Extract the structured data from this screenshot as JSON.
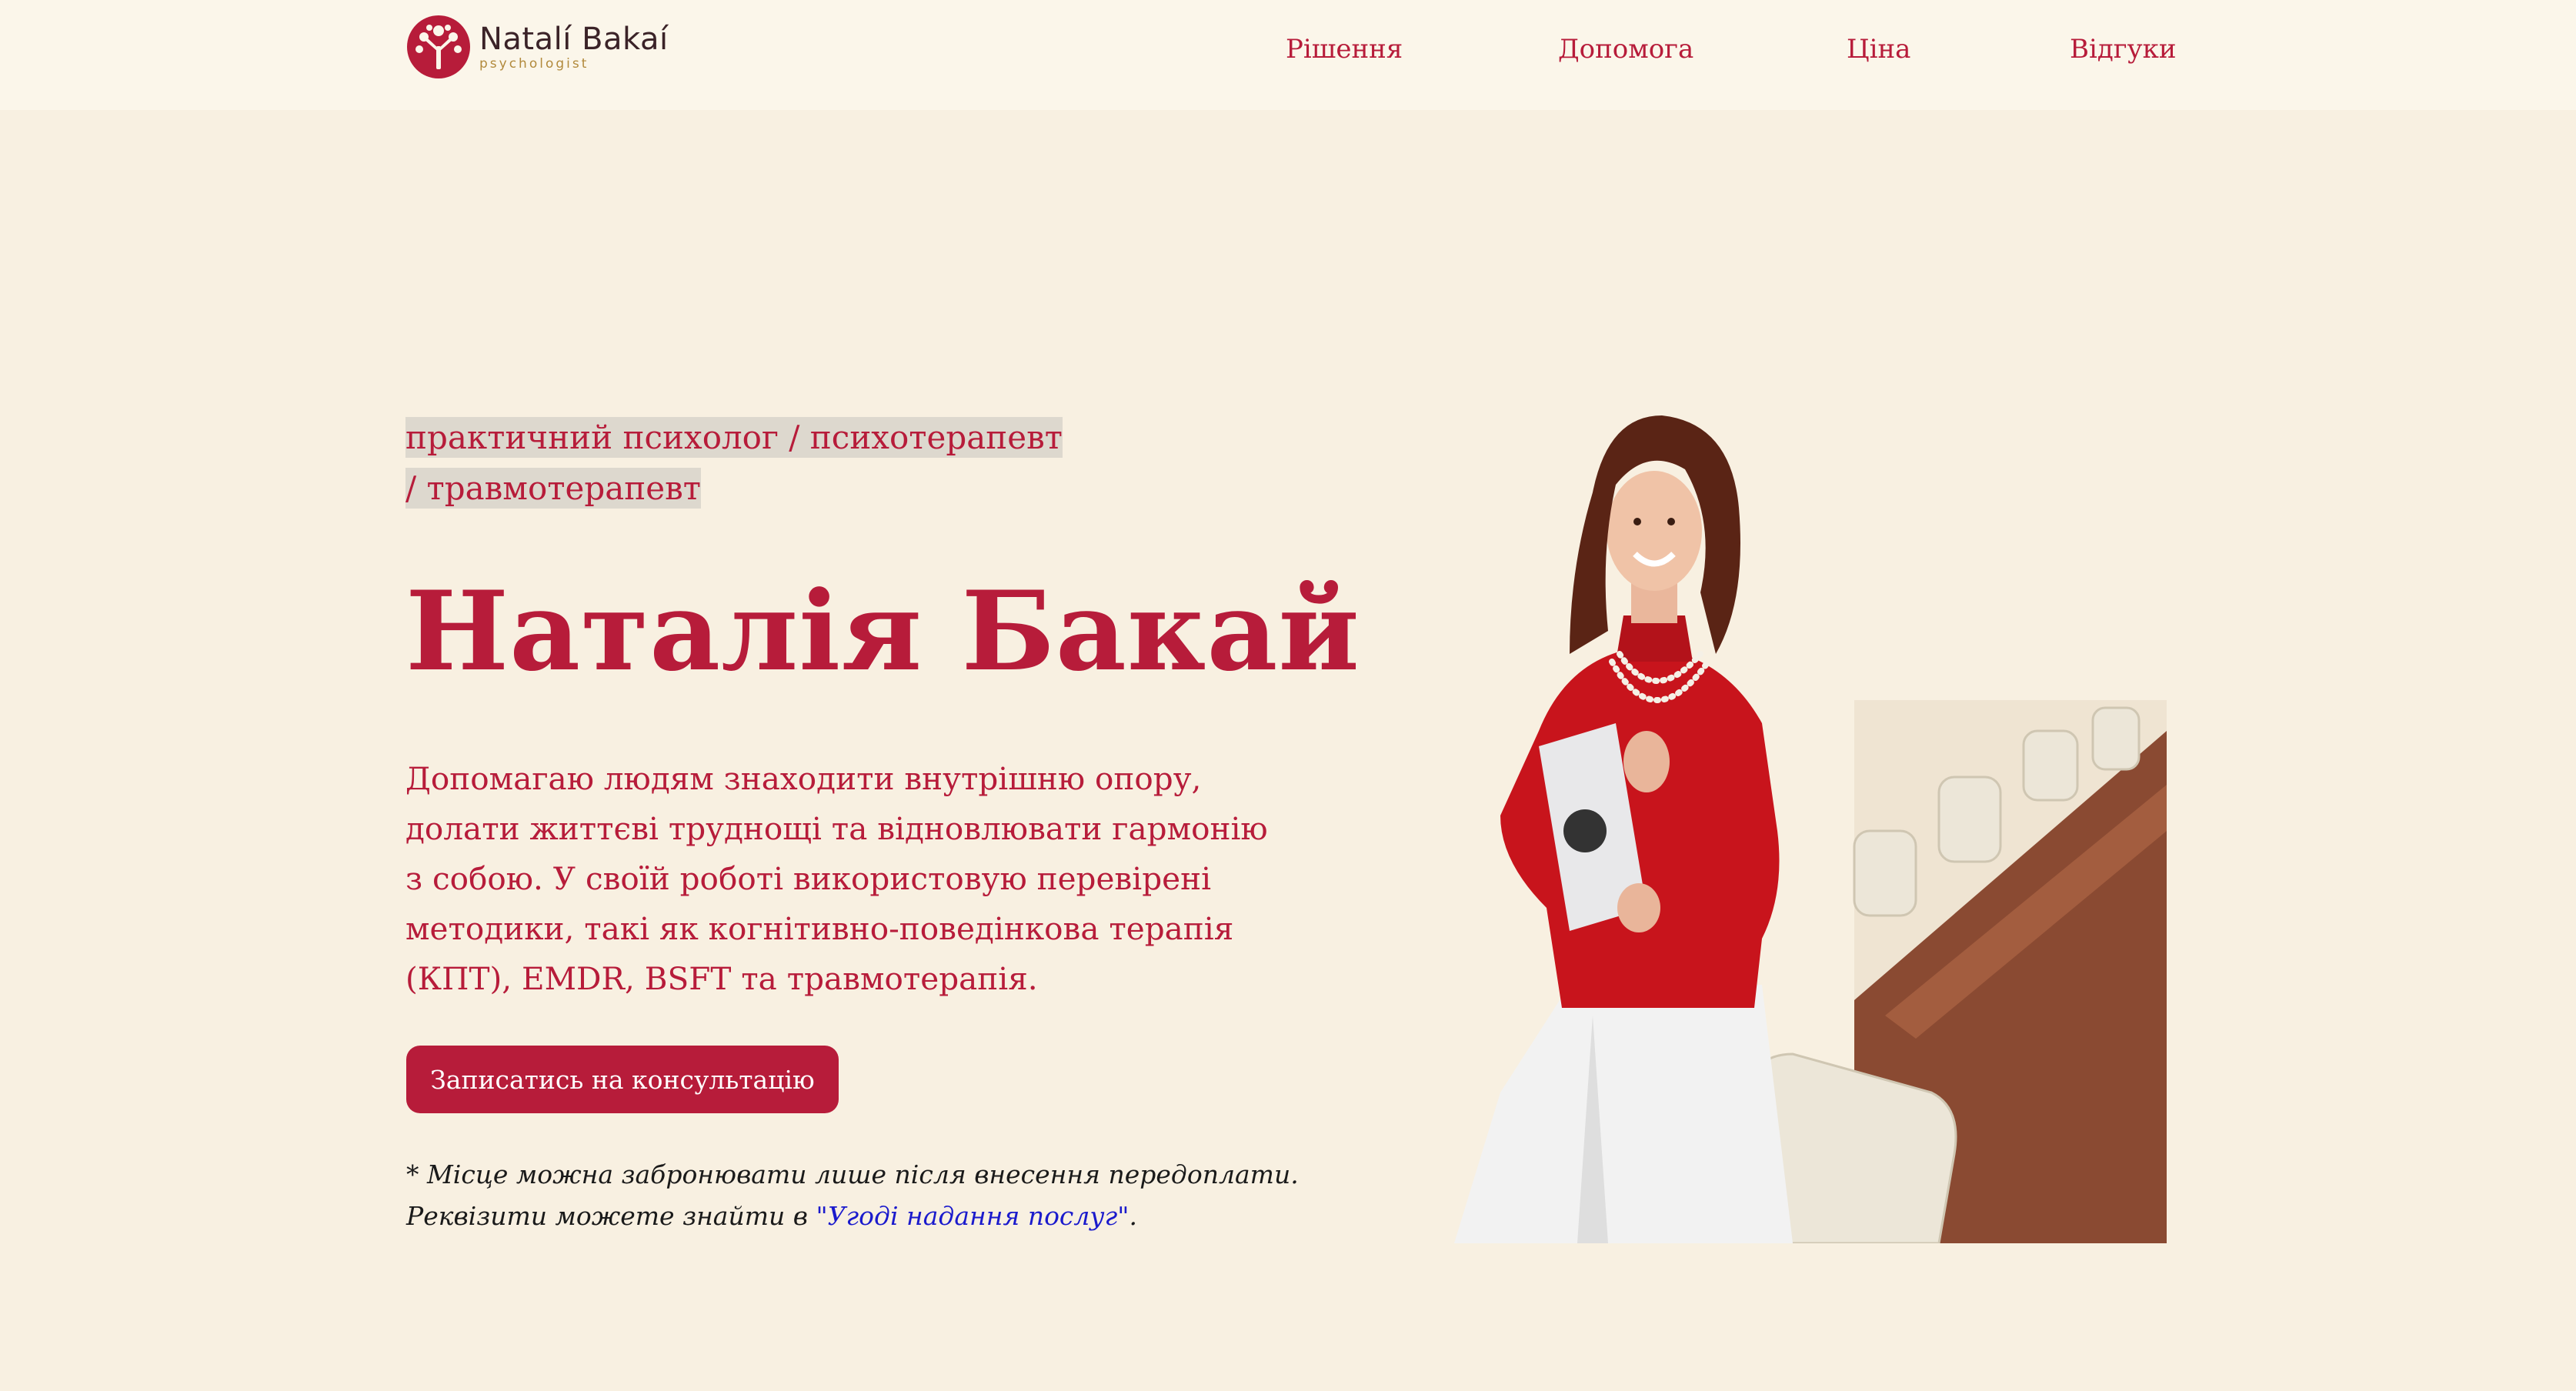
{
  "logo": {
    "name": "Natalí Bakaí",
    "subtitle": "psychologist"
  },
  "nav": [
    "Рішення",
    "Допомога",
    "Ціна",
    "Відгуки"
  ],
  "hero": {
    "tagline": "практичний психолог / психотерапевт / травмотерапевт",
    "title": "Наталія Бакай",
    "description": "Допомагаю людям знаходити внутрішню опору, долати життєві труднощі та відновлювати гармонію з собою. У своїй роботі використовую перевірені методики, такі як когнітивно-поведінкова терапія (КПТ), EMDR, BSFT та травмотерапія.",
    "cta_label": "Записатись на консультацію",
    "note_line1": "* Місце можна забронювати лише після внесення передоплати.",
    "note_line2_prefix": "Реквізити можете знайти в ",
    "note_link": "\"Угоді надання послуг\"",
    "note_line2_suffix": "."
  },
  "colors": {
    "accent": "#b71c3a",
    "background": "#f8f0e1",
    "header_background": "#fbf6ea",
    "link": "#1a1acc"
  },
  "icons": {
    "logo": "tree-icon",
    "photo": "portrait-photo"
  }
}
